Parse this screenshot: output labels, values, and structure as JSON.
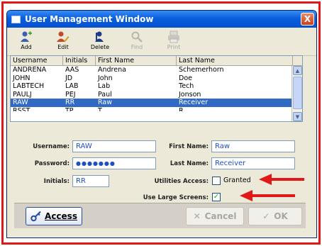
{
  "window": {
    "title": "User Management Window",
    "close_glyph": "X"
  },
  "toolbar": {
    "buttons": [
      {
        "label": "Add",
        "icon": "add-user-icon",
        "enabled": true
      },
      {
        "label": "Edit",
        "icon": "edit-user-icon",
        "enabled": true
      },
      {
        "label": "Delete",
        "icon": "delete-user-icon",
        "enabled": true
      },
      {
        "label": "Find",
        "icon": "find-icon",
        "enabled": false
      },
      {
        "label": "Print",
        "icon": "print-icon",
        "enabled": false
      }
    ]
  },
  "grid": {
    "columns": [
      "Username",
      "Initials",
      "First Name",
      "Last Name"
    ],
    "rows": [
      [
        "ANDRENA",
        "AAS",
        "Andrena",
        "Schemerhorn"
      ],
      [
        "JOHN",
        "JD",
        "John",
        "Doe"
      ],
      [
        "LABTECH",
        "LAB",
        "Lab",
        "Tech"
      ],
      [
        "PAULJ",
        "PEJ",
        "Paul",
        "Jonson"
      ],
      [
        "RAW",
        "RR",
        "Raw",
        "Receiver"
      ],
      [
        "RSST",
        "TP",
        "T",
        "R"
      ]
    ],
    "selected_row": 4
  },
  "form": {
    "username_label": "Username:",
    "username_value": "RAW",
    "password_label": "Password:",
    "password_value": "●●●●●●●",
    "initials_label": "Initials:",
    "initials_value": "RR",
    "first_name_label": "First Name:",
    "first_name_value": "Raw",
    "last_name_label": "Last Name:",
    "last_name_value": "Receiver",
    "utilities_label": "Utilities Access:",
    "utilities_checked": false,
    "utilities_text": "Granted",
    "large_screens_label": "Use Large Screens:",
    "large_screens_checked": true,
    "check_glyph": "✓"
  },
  "buttons": {
    "access_label": "Access",
    "cancel_label": "Cancel",
    "ok_label": "OK",
    "cancel_glyph": "✕",
    "ok_glyph": "✓"
  },
  "colors": {
    "frame": "#e01818",
    "arrow": "#e01818",
    "selection": "#316ac5",
    "titlebar": "#0a5fdc"
  }
}
